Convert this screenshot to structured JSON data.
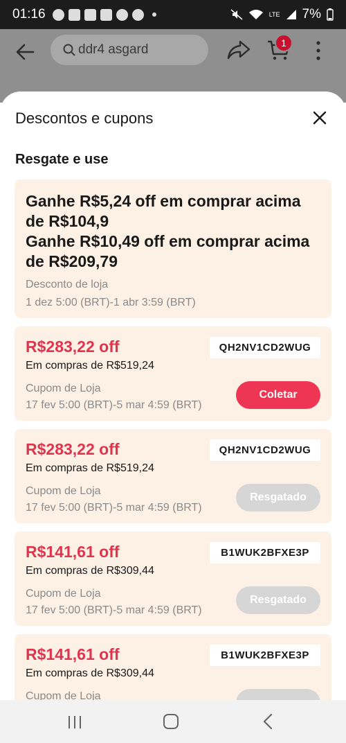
{
  "status_bar": {
    "time": "01:16",
    "battery": "7%",
    "network": "LTE"
  },
  "header": {
    "search_value": "ddr4 asgard",
    "cart_count": "1"
  },
  "sheet": {
    "title": "Descontos e cupons",
    "section_title": "Resgate e use"
  },
  "store_discount": {
    "line1": "Ganhe R$5,24 off em comprar acima de R$104,9",
    "line2": "Ganhe R$10,49 off em comprar acima de R$209,79",
    "type": "Desconto de loja",
    "date": "1 dez 5:00 (BRT)-1 abr 3:59 (BRT)"
  },
  "coupons": [
    {
      "amount": "R$283,22 off",
      "min": "Em compras de R$519,24",
      "type": "Cupom de Loja",
      "date": "17 fev 5:00 (BRT)-5 mar 4:59 (BRT)",
      "code": "QH2NV1CD2WUG",
      "button": "Coletar",
      "state": "active"
    },
    {
      "amount": "R$283,22 off",
      "min": "Em compras de R$519,24",
      "type": "Cupom de Loja",
      "date": "17 fev 5:00 (BRT)-5 mar 4:59 (BRT)",
      "code": "QH2NV1CD2WUG",
      "button": "Resgatado",
      "state": "done"
    },
    {
      "amount": "R$141,61 off",
      "min": "Em compras de R$309,44",
      "type": "Cupom de Loja",
      "date": "17 fev 5:00 (BRT)-5 mar 4:59 (BRT)",
      "code": "B1WUK2BFXE3P",
      "button": "Resgatado",
      "state": "done"
    },
    {
      "amount": "R$141,61 off",
      "min": "Em compras de R$309,44",
      "type": "Cupom de Loja",
      "date": "",
      "code": "B1WUK2BFXE3P",
      "button": "",
      "state": "done"
    }
  ],
  "colors": {
    "accent": "#ee3553",
    "card_bg": "#fdf0e4",
    "amount_red": "#e0344e",
    "disabled": "#d6d6d6"
  }
}
